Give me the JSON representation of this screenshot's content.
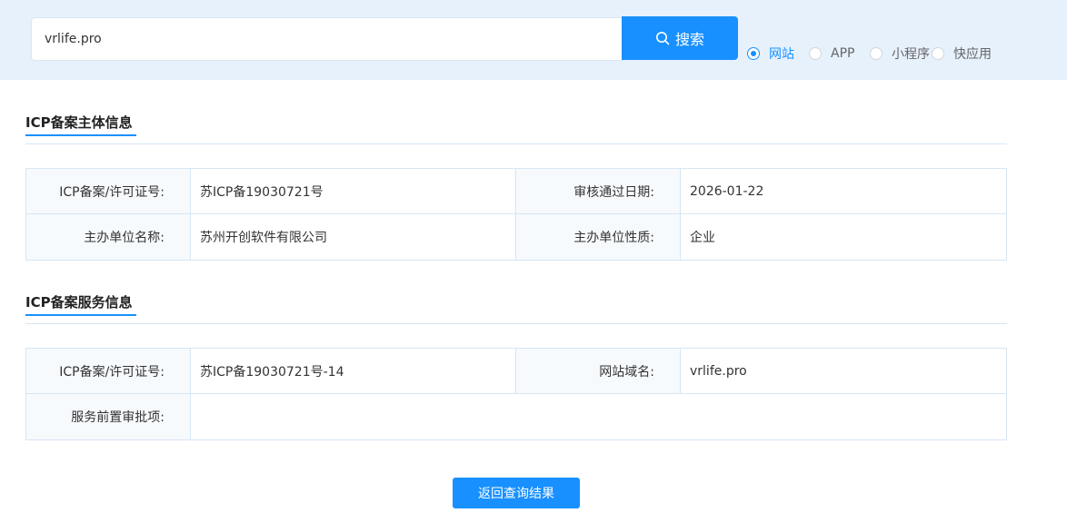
{
  "search": {
    "query": "vrlife.pro",
    "button_label": "搜索",
    "options": [
      {
        "label": "网站",
        "checked": true
      },
      {
        "label": "APP",
        "checked": false
      },
      {
        "label": "小程序",
        "checked": false
      },
      {
        "label": "快应用",
        "checked": false
      }
    ]
  },
  "entity": {
    "title": "ICP备案主体信息",
    "rows": [
      {
        "label1": "ICP备案/许可证号:",
        "value1": "苏ICP备19030721号",
        "label2": "审核通过日期:",
        "value2": "2026-01-22"
      },
      {
        "label1": "主办单位名称:",
        "value1": "苏州开创软件有限公司",
        "label2": "主办单位性质:",
        "value2": "企业"
      }
    ]
  },
  "service": {
    "title": "ICP备案服务信息",
    "row1": {
      "label1": "ICP备案/许可证号:",
      "value1": "苏ICP备19030721号-14",
      "label2": "网站域名:",
      "value2": "vrlife.pro"
    },
    "row2": {
      "label": "服务前置审批项:",
      "value": ""
    }
  },
  "back_button_label": "返回查询结果",
  "colors": {
    "accent": "#1890ff",
    "band": "#e6f1fc",
    "border": "#d6e6f3"
  },
  "icons": {
    "search": "search-icon"
  }
}
